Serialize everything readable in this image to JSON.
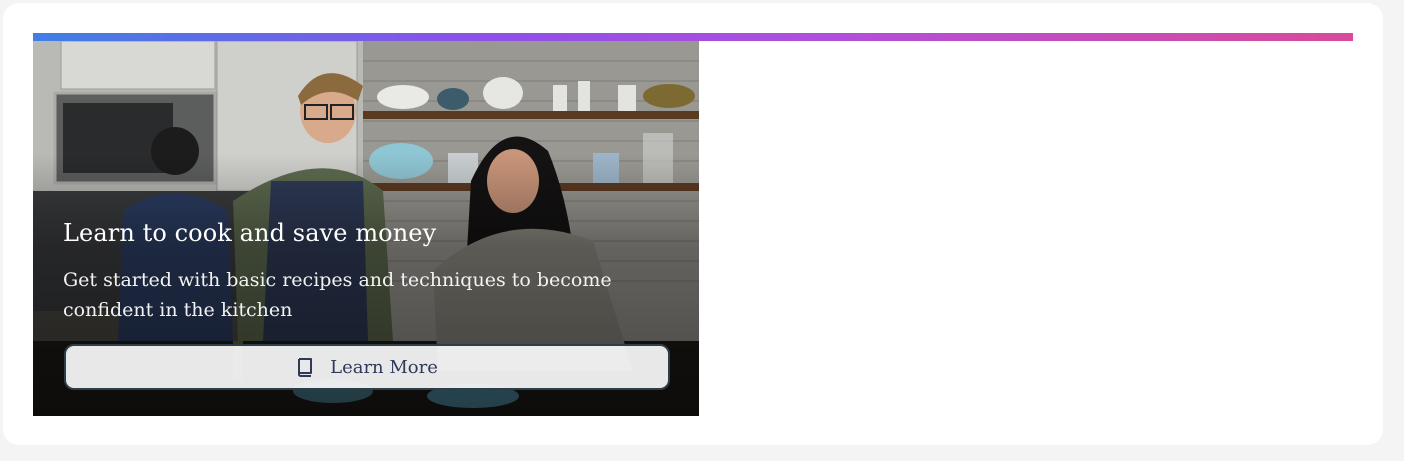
{
  "promo": {
    "title": "Learn to cook and save money",
    "subtitle": "Get started with basic recipes and techniques to become confident in the kitchen",
    "button_label": "Learn More",
    "button_icon": "book-icon",
    "photo_alt": "Two people cooking together in a kitchen"
  },
  "colors": {
    "accent_start": "#3f7fe6",
    "accent_mid": "#b04fdc",
    "accent_end": "#d94a9a",
    "button_text": "#2d3a5a",
    "button_border": "#2c3e4a"
  }
}
